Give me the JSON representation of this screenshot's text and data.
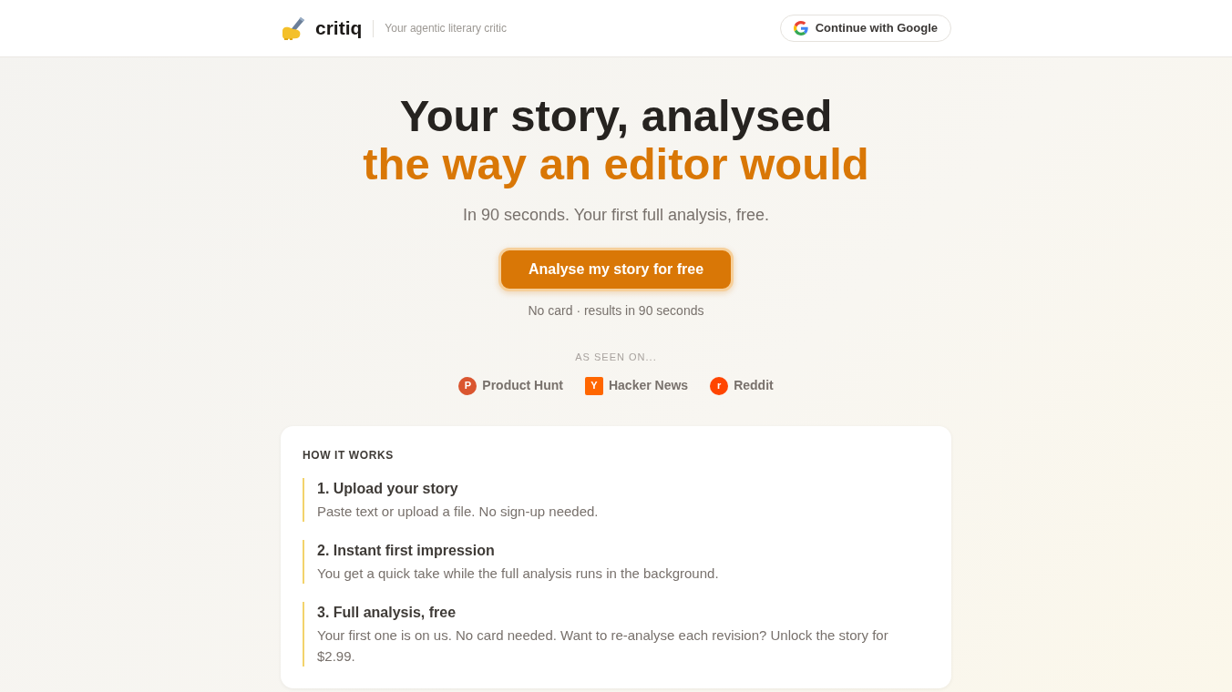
{
  "header": {
    "brand": "critiq",
    "tagline": "Your agentic literary critic",
    "signin_button": "Continue with Google"
  },
  "hero": {
    "title": "Your story, analysed",
    "title_accent": "the way an editor would",
    "subtitle": "In 90 seconds. Your first full analysis, free.",
    "cta_button": "Analyse my story for free",
    "note": "No card · results in 90 seconds"
  },
  "seen_on": {
    "label": "AS SEEN ON...",
    "sites": [
      {
        "letter": "P",
        "name": "Product Hunt",
        "color": "#da552f",
        "kind": "round"
      },
      {
        "letter": "Y",
        "name": "Hacker News",
        "color": "#ff6600",
        "kind": "square"
      },
      {
        "letter": "r",
        "name": "Reddit",
        "color": "#ff4500",
        "kind": "round"
      }
    ]
  },
  "how_it_works": {
    "heading": "HOW IT WORKS",
    "steps": [
      {
        "title": "1. Upload your story",
        "text": "Paste text or upload a file. No sign-up needed."
      },
      {
        "title": "2. Instant first impression",
        "text": "You get a quick take while the full analysis runs in the background."
      },
      {
        "title": "3. Full analysis, free",
        "text": "Your first one is on us. No card needed. Want to re-analyse each revision? Unlock the story for $2.99."
      }
    ]
  }
}
